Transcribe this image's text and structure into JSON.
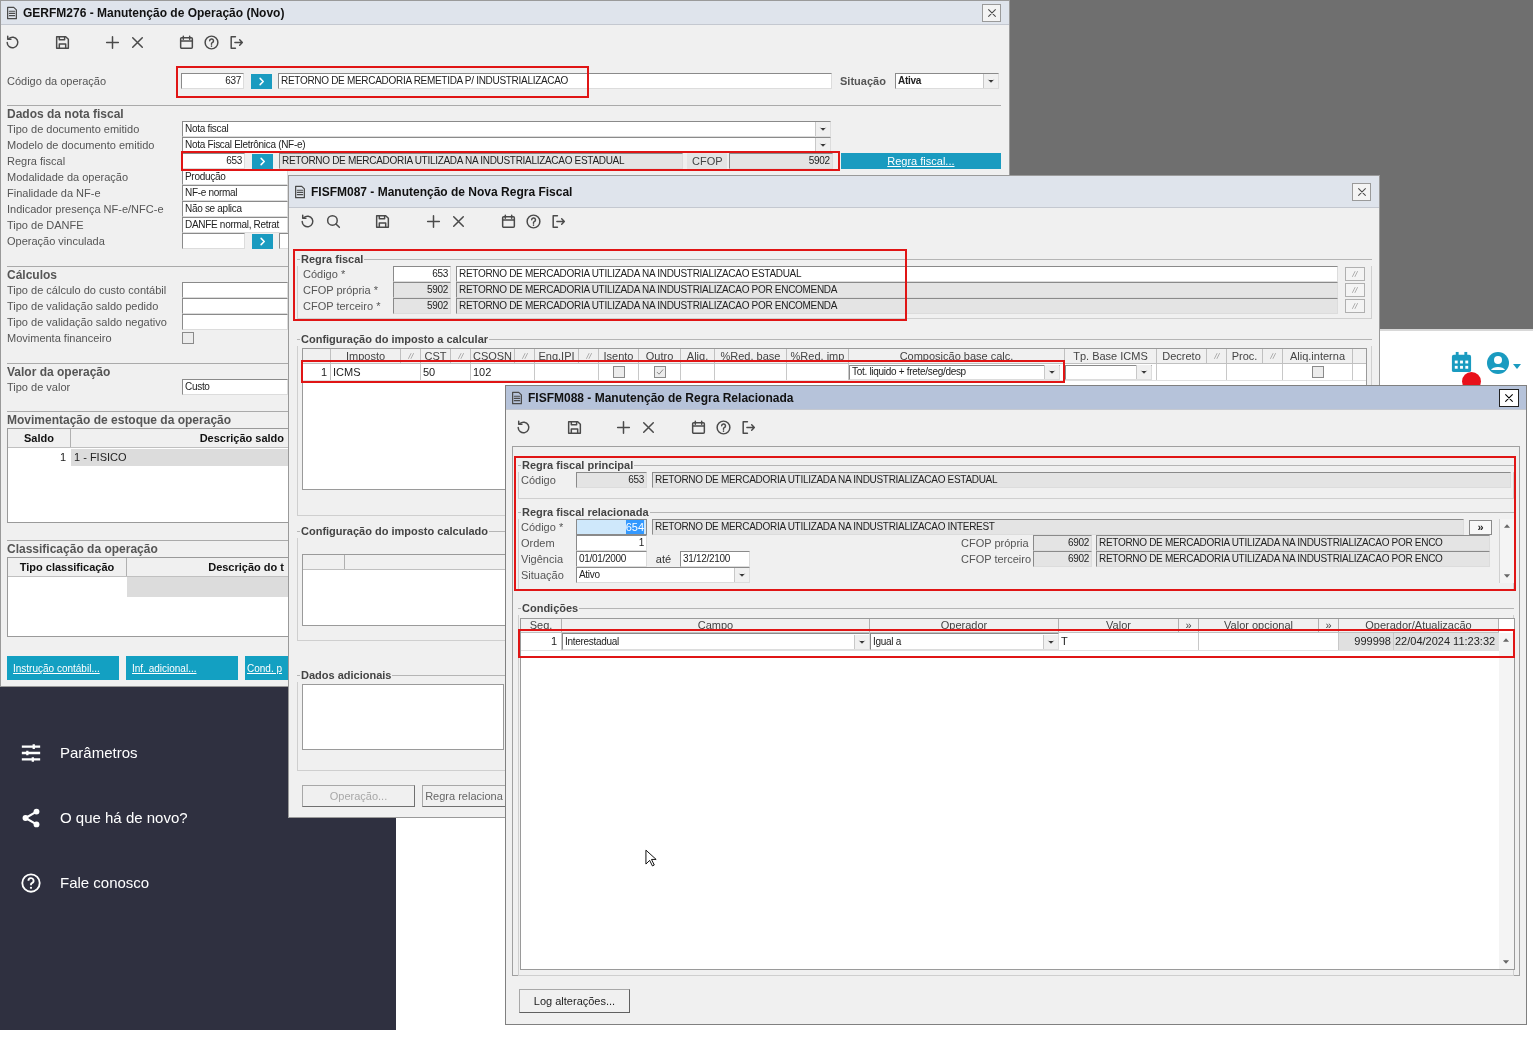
{
  "desktop": {
    "menu_items": [
      {
        "label": "Parâmetros"
      },
      {
        "label": "O que há de novo?"
      },
      {
        "label": "Fale conosco"
      }
    ]
  },
  "operation_window": {
    "title": "GERFM276 - Manutenção de Operação (Novo)",
    "operation": {
      "label": "Código da operação",
      "code": "637",
      "description": "RETORNO DE MERCADORIA REMETIDA P/ INDUSTRIALIZACAO",
      "highlighted": true
    },
    "status": {
      "label": "Situação",
      "value": "Ativa"
    },
    "sections": [
      {
        "title": "Dados da nota fiscal",
        "fields": [
          {
            "kind": "select",
            "label": "Tipo de documento emitido",
            "value": "Nota fiscal"
          },
          {
            "kind": "select",
            "label": "Modelo de documento emitido",
            "value": "Nota Fiscal Eletrônica (NF-e)"
          },
          {
            "kind": "rule",
            "label": "Regra fiscal",
            "code": "653",
            "description": "RETORNO DE MERCADORIA UTILIZADA NA INDUSTRIALIZACAO ESTADUAL",
            "cfop_label": "CFOP",
            "cfop": "5902",
            "button": "Regra fiscal...",
            "highlighted": true
          },
          {
            "kind": "text",
            "label": "Modalidade da operação",
            "value": "Produção"
          },
          {
            "kind": "text",
            "label": "Finalidade da NF-e",
            "value": "NF-e normal"
          },
          {
            "kind": "text",
            "label": "Indicador presença NF-e/NFC-e",
            "value": "Não se aplica"
          },
          {
            "kind": "text",
            "label": "Tipo de DANFE",
            "value": "DANFE normal, Retrat"
          },
          {
            "kind": "code",
            "label": "Operação vinculada"
          }
        ]
      },
      {
        "title": "Cálculos",
        "fields": [
          {
            "kind": "text",
            "label": "Tipo de cálculo do custo contábil"
          },
          {
            "kind": "text",
            "label": "Tipo de validação saldo pedido"
          },
          {
            "kind": "text",
            "label": "Tipo de validação saldo negativo"
          },
          {
            "kind": "checkbox",
            "label": "Movimenta financeiro",
            "checked": false
          }
        ]
      },
      {
        "title": "Valor da operação",
        "fields": [
          {
            "kind": "text",
            "label": "Tipo de valor",
            "value": "Custo"
          }
        ]
      }
    ],
    "stock_table": {
      "title": "Movimentação de estoque da operação",
      "columns": [
        "Saldo",
        "Descrição saldo"
      ],
      "rows": [
        [
          "1",
          "1 - FISICO"
        ]
      ]
    },
    "classification_table": {
      "title": "Classificação da operação",
      "columns": [
        "Tipo classificação",
        "Descrição do t"
      ]
    },
    "buttons": [
      "Instrução contábil...",
      "Inf. adicional...",
      "Cond. p"
    ]
  },
  "rule_window": {
    "title": "FISFM087 - Manutenção de Nova Regra Fiscal",
    "rule_group": {
      "title": "Regra fiscal",
      "highlighted": true,
      "rows": [
        {
          "label": "Código *",
          "code": "653",
          "description": "RETORNO DE MERCADORIA UTILIZADA NA INDUSTRIALIZACAO ESTADUAL",
          "readonly": false
        },
        {
          "label": "CFOP própria *",
          "code": "5902",
          "description": "RETORNO DE MERCADORIA UTILIZADA NA INDUSTRIALIZACAO POR ENCOMENDA",
          "readonly": true
        },
        {
          "label": "CFOP terceiro *",
          "code": "5902",
          "description": "RETORNO DE MERCADORIA UTILIZADA NA INDUSTRIALIZACAO POR ENCOMENDA",
          "readonly": true
        }
      ]
    },
    "tax_group": {
      "title": "Configuração do imposto a calcular",
      "columns": [
        {
          "label": "Imposto",
          "filter": true
        },
        {
          "label": "CST",
          "filter": true
        },
        {
          "label": "CSOSN",
          "filter": true
        },
        {
          "label": "Enq.IPI",
          "filter": true
        },
        {
          "label": "Isento",
          "filter": false
        },
        {
          "label": "Outro",
          "filter": false
        },
        {
          "label": "Aliq.",
          "filter": false
        },
        {
          "label": "%Red. base",
          "filter": false
        },
        {
          "label": "%Red. imp",
          "filter": false
        },
        {
          "label": "Composição base calc.",
          "filter": false
        },
        {
          "label": "Tp. Base ICMS",
          "filter": false
        },
        {
          "label": "Decreto",
          "filter": true
        },
        {
          "label": "Proc.",
          "filter": true
        },
        {
          "label": "Aliq.interna",
          "filter": false
        }
      ],
      "rows": [
        {
          "seq": "1",
          "highlighted": true,
          "cells": [
            {
              "kind": "text",
              "value": "ICMS"
            },
            {
              "kind": "text",
              "value": "50"
            },
            {
              "kind": "text",
              "value": "102"
            },
            {
              "kind": "blank"
            },
            {
              "kind": "check",
              "checked": false
            },
            {
              "kind": "check",
              "checked": true
            },
            {
              "kind": "blank"
            },
            {
              "kind": "blank"
            },
            {
              "kind": "blank"
            },
            {
              "kind": "select",
              "value": "Tot. liquido + frete/seg/desp"
            },
            {
              "kind": "select"
            },
            {
              "kind": "blank"
            },
            {
              "kind": "blank"
            },
            {
              "kind": "check",
              "checked": false
            }
          ]
        }
      ]
    },
    "calculated_group": {
      "title": "Configuração do imposto calculado"
    },
    "additional_group": {
      "title": "Dados adicionais"
    },
    "buttons": [
      {
        "label": "Operação...",
        "disabled": true
      },
      {
        "label": "Regra relaciona",
        "disabled": false
      }
    ]
  },
  "related_rule_window": {
    "title": "FISFM088 - Manutenção de Regra Relacionada",
    "rules_highlighted": true,
    "principal": {
      "title": "Regra fiscal principal",
      "label": "Código",
      "code": "653",
      "description": "RETORNO DE MERCADORIA UTILIZADA NA INDUSTRIALIZACAO ESTADUAL"
    },
    "related": {
      "title": "Regra fiscal relacionada",
      "code_label": "Código *",
      "code": "654",
      "focused": true,
      "description": "RETORNO DE MERCADORIA UTILIZADA NA INDUSTRIALIZACAO INTEREST",
      "more_button": "»",
      "order_label": "Ordem",
      "order": "1",
      "validity_label": "Vigência",
      "valid_from": "01/01/2000",
      "until_label": "até",
      "valid_to": "31/12/2100",
      "status_label": "Situação",
      "status": "Ativo",
      "cfops": [
        {
          "label": "CFOP própria",
          "code": "6902",
          "description": "RETORNO DE MERCADORIA UTILIZADA NA INDUSTRIALIZACAO POR ENCO"
        },
        {
          "label": "CFOP terceiro",
          "code": "6902",
          "description": "RETORNO DE MERCADORIA UTILIZADA NA INDUSTRIALIZACAO POR ENCO"
        }
      ]
    },
    "conditions": {
      "title": "Condições",
      "columns": [
        "Seq.",
        "Campo",
        "Operador",
        "Valor",
        "»",
        "Valor opcional",
        "»",
        "Operador/Atualização"
      ],
      "rows": [
        {
          "seq": "1",
          "field": "Interestadual",
          "operator": "Igual a",
          "value": "T",
          "user": "999998",
          "updated": "22/04/2024 11:23:32",
          "highlighted": true
        }
      ]
    },
    "log_button": "Log alterações..."
  }
}
